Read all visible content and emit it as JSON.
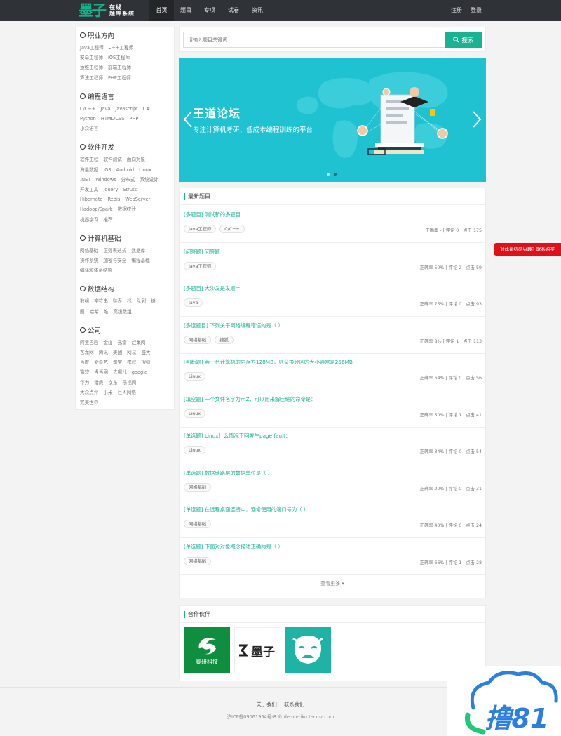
{
  "header": {
    "logo_main": "墨子",
    "logo_line1": "在线",
    "logo_line2": "题库系统",
    "nav": [
      "首页",
      "题目",
      "专项",
      "试卷",
      "资讯"
    ],
    "register": "注册",
    "login": "登录"
  },
  "sidebar": {
    "categories": [
      {
        "title": "职业方向",
        "rows": [
          [
            "Java工程师",
            "C++工程师"
          ],
          [
            "安卓工程师",
            "iOS工程师"
          ],
          [
            "运维工程师",
            "前端工程师"
          ],
          [
            "算法工程师",
            "PHP工程师"
          ]
        ]
      },
      {
        "title": "编程语言",
        "rows": [
          [
            "C/C++",
            "Java",
            "Javascript",
            "C#"
          ],
          [
            "Python",
            "HTML/CSS",
            "PHP"
          ],
          [
            "小众语言"
          ]
        ]
      },
      {
        "title": "软件开发",
        "rows": [
          [
            "软件工程",
            "软件测试",
            "面向对象"
          ],
          [
            "海量数据",
            "iOS",
            "Android",
            "Linux"
          ],
          [
            ".NET",
            "Windows",
            "分布式",
            "系统设计"
          ],
          [
            "开发工具",
            "Jquery",
            "Struts"
          ],
          [
            "Hibernate",
            "Redis",
            "WebServer"
          ],
          [
            "Hadoop/Spark",
            "数据统计"
          ],
          [
            "机器学习",
            "推荐"
          ]
        ]
      },
      {
        "title": "计算机基础",
        "rows": [
          [
            "网络基础",
            "正则表达式",
            "数据库"
          ],
          [
            "操作系统",
            "加密与安全",
            "编程基础"
          ],
          [
            "编译和体系结构"
          ]
        ]
      },
      {
        "title": "数据结构",
        "rows": [
          [
            "数组",
            "字符串",
            "链表",
            "栈",
            "队列",
            "树"
          ],
          [
            "图",
            "哈希",
            "堆",
            "高级数组"
          ]
        ]
      },
      {
        "title": "公司",
        "rows": [
          [
            "阿里巴巴",
            "金山",
            "迅雷",
            "赶集网"
          ],
          [
            "艺龙网",
            "腾讯",
            "美团",
            "网易",
            "盛大"
          ],
          [
            "百度",
            "爱奇艺",
            "淘宝",
            "携程",
            "搜狐"
          ],
          [
            "微软",
            "当当网",
            "去哪儿",
            "google"
          ],
          [
            "华为",
            "猎虎",
            "京东",
            "乐视网"
          ],
          [
            "大众点评",
            "小米",
            "巨人网络"
          ],
          [
            "完美世界"
          ]
        ]
      }
    ]
  },
  "search": {
    "placeholder": "请输入题目关键词",
    "button": "搜索"
  },
  "banner": {
    "title": "王道论坛",
    "subtitle": "专注计算机考研、低成本编程训练的平台",
    "bg_color": "#1fc2d1"
  },
  "questions": {
    "heading": "最新题目",
    "items": [
      {
        "title": "[多题目] 测试新的多题目",
        "tags": [
          "Java工程师",
          "C/C++"
        ],
        "meta": "正确率 - | 评论 0 | 点击 175"
      },
      {
        "title": "[问答题] 问答题",
        "tags": [
          "Java工程师"
        ],
        "meta": "正确率 50% | 评论 2 | 点击 59"
      },
      {
        "title": "[多题目] 大沙发是发顺丰",
        "tags": [
          "Java"
        ],
        "meta": "正确率 75% | 评论 0 | 点击 93"
      },
      {
        "title": "[多选题目] 下列关于网络编程错误的是（ ）",
        "tags": [
          "网络基础",
          "搜狐"
        ],
        "meta": "正确率 8% | 评论 1 | 点击 113"
      },
      {
        "title": "[判断题] 若一台计算机的内存为128MB，则交换分区的大小通常是256MB",
        "tags": [
          "Linux"
        ],
        "meta": "正确率 64% | 评论 0 | 点击 56"
      },
      {
        "title": "[填空题] 一个文件名字为rr.Z，可以用来解压缩的命令是：",
        "tags": [
          "Linux"
        ],
        "meta": "正确率 50% | 评论 1 | 点击 41"
      },
      {
        "title": "[单选题] Linux什么情况下回发生page fault：",
        "tags": [
          "Linux"
        ],
        "meta": "正确率 34% | 评论 0 | 点击 54"
      },
      {
        "title": "[单选题] 数据链路层的数据单位是（ ）",
        "tags": [
          "网络基础"
        ],
        "meta": "正确率 20% | 评论 0 | 点击 31"
      },
      {
        "title": "[单选题] 在远程桌面连接中，通常使用的端口号为（ ）",
        "tags": [
          "网络基础"
        ],
        "meta": "正确率 40% | 评论 0 | 点击 24"
      },
      {
        "title": "[单选题] 下面对对象概念描述正确的是（ ）",
        "tags": [
          "网络基础"
        ],
        "meta": "正确率 66% | 评论 1 | 点击 28"
      }
    ],
    "more": "查看更多 ▾"
  },
  "partners": {
    "heading": "合作伙伴",
    "logo1_text": "泰研科技",
    "logo2_text": "墨子"
  },
  "footer": {
    "about": "关于我们",
    "contact": "联系我们",
    "copyright": "沪ICP备09061954号-8 © demo-tiku.tecmz.com"
  },
  "float_contact": "对此系统感兴趣？联系购买",
  "watermark_text": "撸81",
  "accent_color": "#19b393"
}
